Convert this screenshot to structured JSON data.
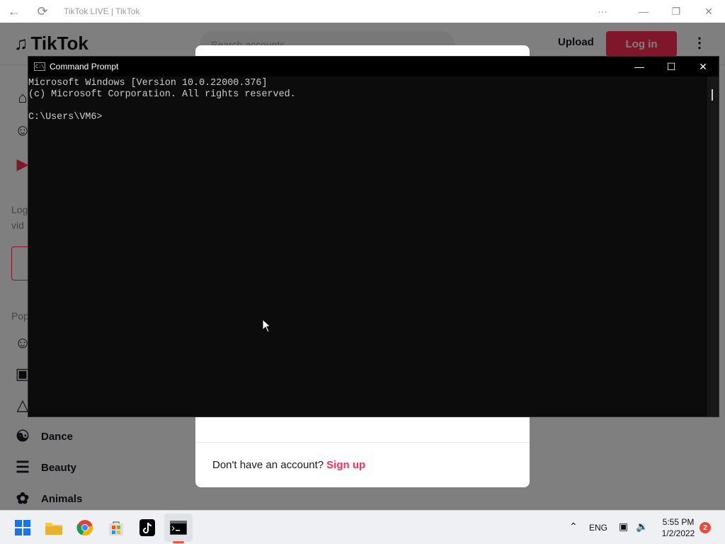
{
  "browser": {
    "title": "TikTok LIVE | TikTok",
    "back_icon": "back-arrow-icon",
    "refresh_icon": "refresh-icon",
    "more_icon": "ellipsis-icon"
  },
  "tiktok": {
    "logo": "TikTok",
    "search_placeholder": "Search accounts",
    "upload_label": "Upload",
    "login_label": "Log in",
    "sidebar_hint_1": "Log",
    "sidebar_hint_2": "vid",
    "popular_label": "Pop",
    "categories": [
      {
        "label": "Dance",
        "icon": "dance-icon"
      },
      {
        "label": "Beauty",
        "icon": "comb-icon"
      },
      {
        "label": "Animals",
        "icon": "paw-icon"
      }
    ],
    "brand_color": "#fe2c55"
  },
  "modal": {
    "footer_text": "Don't have an account?",
    "signup_label": "Sign up"
  },
  "cmd": {
    "title": "Command Prompt",
    "lines": [
      "Microsoft Windows [Version 10.0.22000.376]",
      "(c) Microsoft Corporation. All rights reserved.",
      "",
      "C:\\Users\\VM6>"
    ]
  },
  "taskbar": {
    "apps": [
      "windows-start-icon",
      "file-explorer-icon",
      "chrome-icon",
      "microsoft-store-icon",
      "tiktok-icon",
      "command-prompt-icon"
    ],
    "language": "ENG",
    "time": "5:55 PM",
    "date": "1/2/2022",
    "notification_count": "2"
  }
}
